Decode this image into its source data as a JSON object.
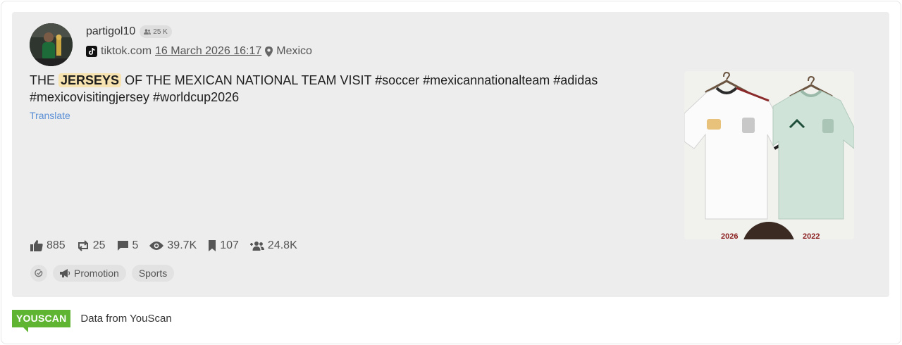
{
  "post": {
    "author": "partigol10",
    "followers_badge": "25 K",
    "source": "tiktok.com",
    "date": "16 March 2026 16:17",
    "location": "Mexico",
    "text_before": "THE ",
    "text_highlight": "JERSEYS",
    "text_after": " OF THE MEXICAN NATIONAL TEAM VISIT #soccer #mexicannationalteam #adidas #mexicovisitingjersey #worldcup2026",
    "translate_label": "Translate",
    "thumbnail_captions": [
      "2026",
      "2022"
    ]
  },
  "stats": {
    "likes": "885",
    "reposts": "25",
    "comments": "5",
    "views": "39.7K",
    "bookmarks": "107",
    "audience": "24.8K"
  },
  "tags": {
    "promotion": "Promotion",
    "sports": "Sports"
  },
  "footer": {
    "logo": "YOUSCAN",
    "text": "Data from YouScan"
  },
  "icons": {
    "like": "thumbs-up-icon",
    "repost": "repost-icon",
    "comment": "comment-icon",
    "view": "eye-icon",
    "bookmark": "bookmark-icon",
    "audience": "audience-icon",
    "location": "location-pin-icon",
    "source": "tiktok-icon"
  },
  "colors": {
    "card_bg": "#ededed",
    "highlight": "#f7e3b0",
    "link": "#5b8fd6",
    "brand_green": "#5fb531"
  }
}
